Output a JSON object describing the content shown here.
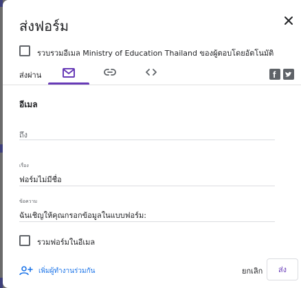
{
  "dialog": {
    "title": "ส่งฟอร์ม",
    "collect_emails_label": "รวบรวมอีเมล Ministry of Education Thailand ของผู้ตอบโดยอัตโนมัติ",
    "send_via_label": "ส่งผ่าน",
    "tabs": [
      {
        "icon": "mail-icon",
        "selected": true
      },
      {
        "icon": "link-icon",
        "selected": false
      },
      {
        "icon": "embed-icon",
        "selected": false
      }
    ],
    "social": [
      "facebook-icon",
      "twitter-icon"
    ],
    "section_title": "อีเมล",
    "to": {
      "placeholder": "ถึง"
    },
    "subject": {
      "label": "เรื่อง",
      "value": "ฟอร์มไม่มีชื่อ"
    },
    "message": {
      "label": "ข้อความ",
      "value": "ฉันเชิญให้คุณกรอกข้อมูลในแบบฟอร์ม:"
    },
    "include_form_label": "รวมฟอร์มในอีเมล",
    "add_collaborators_label": "เพิ่มผู้ทำงานร่วมกัน",
    "cancel_label": "ยกเลิก",
    "send_label": "ส่ง"
  },
  "colors": {
    "accent": "#673ab7",
    "link": "#1a73e8",
    "icon": "#5f6368"
  }
}
